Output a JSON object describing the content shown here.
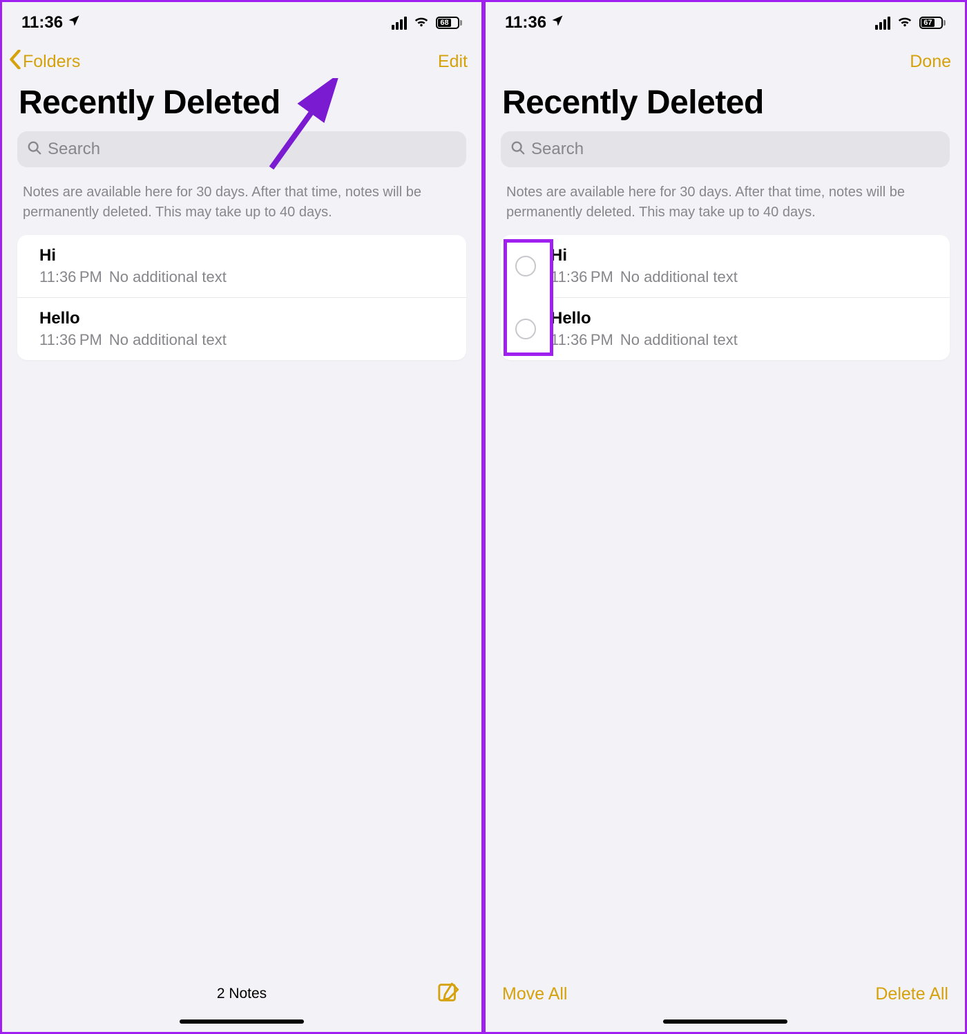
{
  "accent": "#d6a20b",
  "panels": {
    "left": {
      "status": {
        "time": "11:36",
        "battery": "68"
      },
      "nav": {
        "back": "Folders",
        "action": "Edit"
      },
      "title": "Recently Deleted",
      "search_placeholder": "Search",
      "info": "Notes are available here for 30 days. After that time, notes will be permanently deleted. This may take up to 40 days.",
      "notes": [
        {
          "title": "Hi",
          "time": "11:36 PM",
          "preview": "No additional text"
        },
        {
          "title": "Hello",
          "time": "11:36 PM",
          "preview": "No additional text"
        }
      ],
      "toolbar": {
        "count": "2 Notes"
      }
    },
    "right": {
      "status": {
        "time": "11:36",
        "battery": "67"
      },
      "nav": {
        "action": "Done"
      },
      "title": "Recently Deleted",
      "search_placeholder": "Search",
      "info": "Notes are available here for 30 days. After that time, notes will be permanently deleted. This may take up to 40 days.",
      "notes": [
        {
          "title": "Hi",
          "time": "11:36 PM",
          "preview": "No additional text"
        },
        {
          "title": "Hello",
          "time": "11:36 PM",
          "preview": "No additional text"
        }
      ],
      "toolbar": {
        "move": "Move All",
        "delete": "Delete All"
      }
    }
  }
}
